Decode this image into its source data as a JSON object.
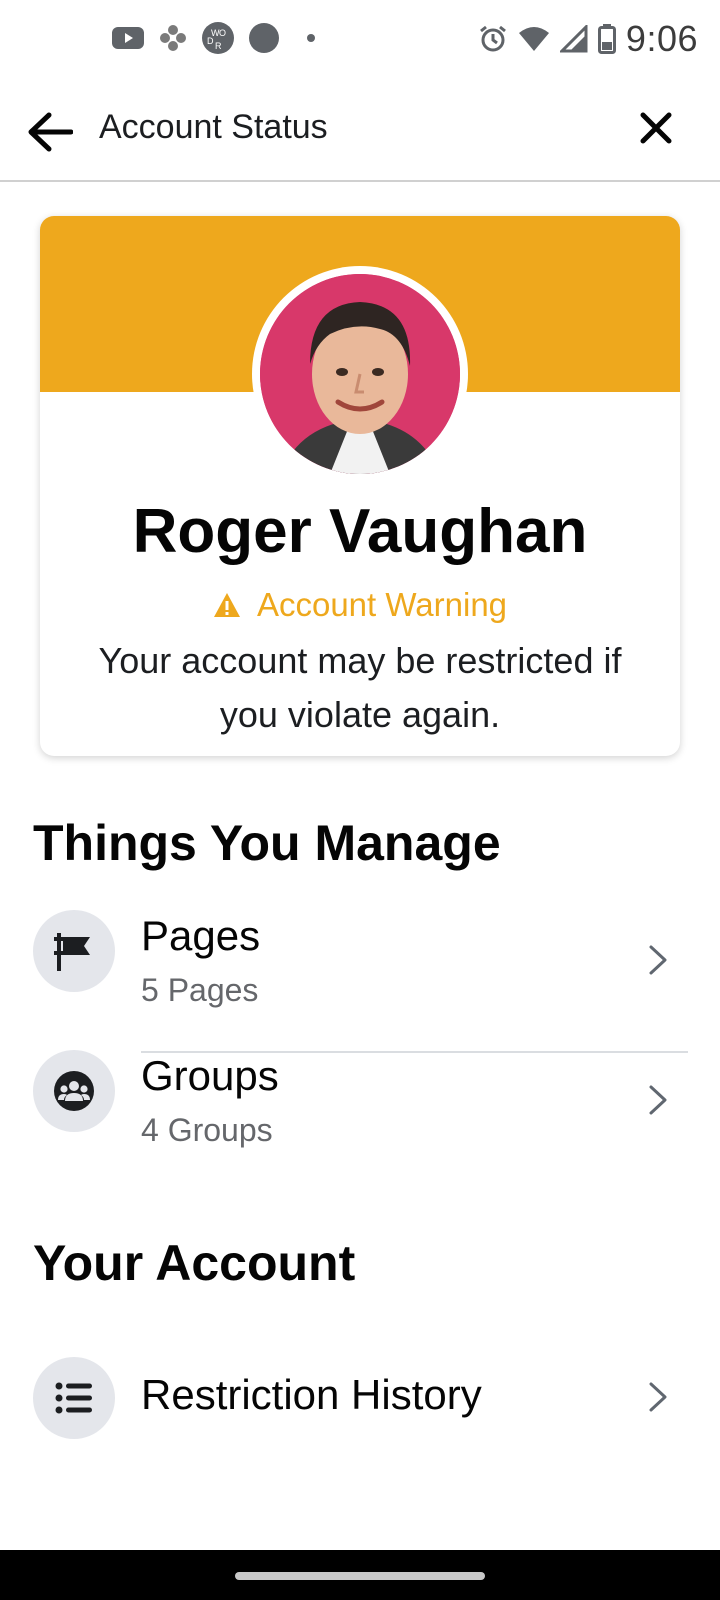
{
  "status_bar": {
    "time": "9:06",
    "left_icons": [
      "youtube-icon",
      "game-controller-icon",
      "words-app-icon",
      "circle-app-icon",
      "dot-icon"
    ],
    "right_icons": [
      "alarm-icon",
      "wifi-icon",
      "cell-signal-icon",
      "battery-icon"
    ]
  },
  "app_bar": {
    "title": "Account Status"
  },
  "profile": {
    "name": "Roger Vaughan",
    "warning_label": "Account Warning",
    "warning_description": "Your account may be restricted if you violate again.",
    "banner_color": "#eea81d"
  },
  "manage_section": {
    "title": "Things You Manage",
    "items": [
      {
        "title": "Pages",
        "subtitle": "5 Pages",
        "icon": "flag-icon"
      },
      {
        "title": "Groups",
        "subtitle": "4 Groups",
        "icon": "groups-icon"
      }
    ]
  },
  "account_section": {
    "title": "Your Account",
    "items": [
      {
        "title": "Restriction History",
        "icon": "list-icon"
      }
    ]
  }
}
